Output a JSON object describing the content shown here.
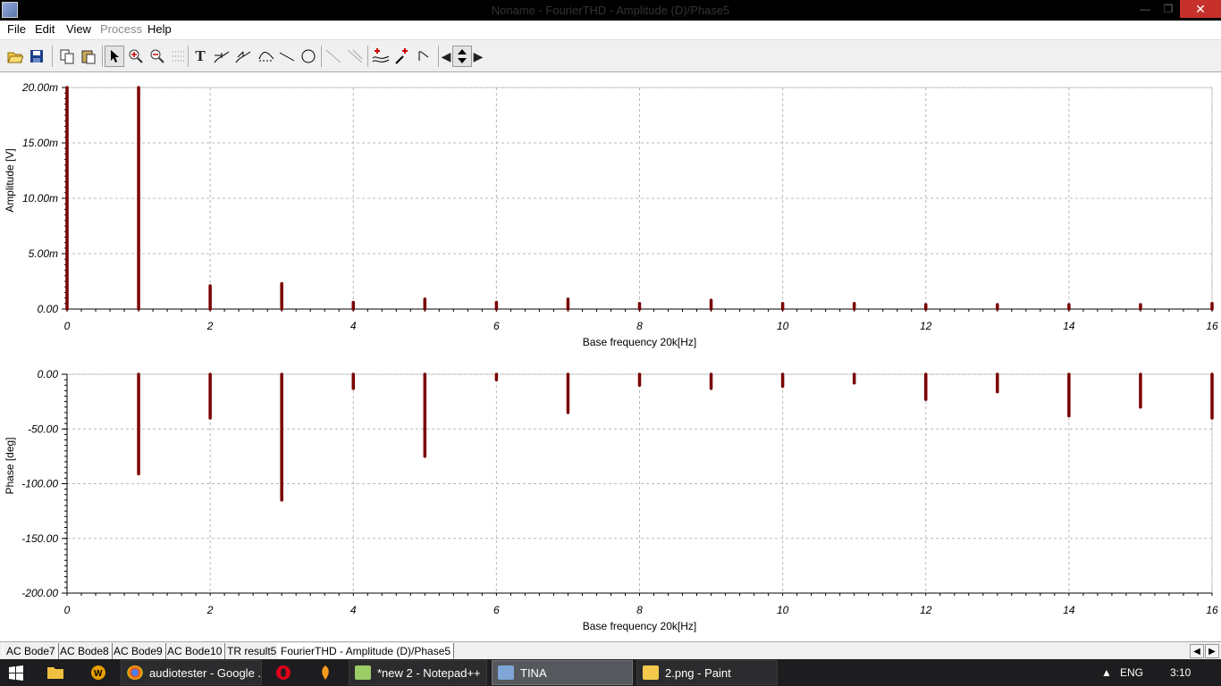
{
  "window": {
    "title": "Noname - FourierTHD - Amplitude (D)/Phase5",
    "minimize_label": "—",
    "maximize_label": "❐",
    "close_label": "✕"
  },
  "menu": [
    "File",
    "Edit",
    "View",
    "Process",
    "Help"
  ],
  "toolbar": {
    "buttons": [
      "open-icon",
      "save-icon",
      "copy-icon",
      "paste-icon",
      "pointer-icon",
      "zoom-in-icon",
      "zoom-100-icon",
      "grid-icon",
      "text-icon",
      "marker-curve-icon",
      "marker-curve2-icon",
      "tangent-icon",
      "line-icon",
      "circle-icon",
      "arrow-diag-icon",
      "arrow-diag2-icon",
      "add-cursor-icon",
      "pick-cursor-icon",
      "hide-icon",
      "scroll-left-icon",
      "scroll-updown-icon",
      "scroll-right-icon"
    ]
  },
  "chart_data": [
    {
      "type": "bar",
      "xlabel": "Base frequency 20k[Hz]",
      "ylabel": "Amplitude [V]",
      "xlim": [
        0,
        16
      ],
      "ylim": [
        0,
        0.02
      ],
      "xticks": [
        "0",
        "2",
        "4",
        "6",
        "8",
        "10",
        "12",
        "14",
        "16"
      ],
      "yticks": [
        "0.00",
        "5.00m",
        "10.00m",
        "15.00m",
        "20.00m"
      ],
      "grid": true,
      "color": "#7a0000",
      "x": [
        0,
        1,
        2,
        3,
        4,
        5,
        6,
        7,
        8,
        9,
        10,
        11,
        12,
        13,
        14,
        15,
        16
      ],
      "values": [
        0.02,
        0.02,
        0.0021,
        0.0023,
        0.0006,
        0.0009,
        0.0006,
        0.0009,
        0.0005,
        0.0008,
        0.0005,
        0.0005,
        0.0004,
        0.0004,
        0.0004,
        0.0004,
        0.0005
      ]
    },
    {
      "type": "bar",
      "xlabel": "Base frequency 20k[Hz]",
      "ylabel": "Phase [deg]",
      "xlim": [
        0,
        16
      ],
      "ylim": [
        -200,
        0
      ],
      "xticks": [
        "0",
        "2",
        "4",
        "6",
        "8",
        "10",
        "12",
        "14",
        "16"
      ],
      "yticks": [
        "0.00",
        "-50.00",
        "-100.00",
        "-150.00",
        "-200.00"
      ],
      "grid": true,
      "color": "#7a0000",
      "x": [
        1,
        2,
        3,
        4,
        5,
        6,
        7,
        8,
        9,
        10,
        11,
        12,
        13,
        14,
        15,
        16
      ],
      "values": [
        -91,
        -40,
        -115,
        -13,
        -75,
        -5,
        -35,
        -10,
        -13,
        -11,
        -8,
        -23,
        -16,
        -38,
        -30,
        -40
      ]
    }
  ],
  "tabs": [
    "AC Bode7",
    "AC Bode8",
    "AC Bode9",
    "AC Bode10",
    "TR result5",
    "FourierTHD - Amplitude (D)/Phase5"
  ],
  "taskbar": {
    "buttons": [
      "audiotester - Google ...",
      "*new  2 - Notepad++",
      "TINA",
      "2.png - Paint"
    ],
    "lang": "ENG",
    "time": "3:10"
  }
}
